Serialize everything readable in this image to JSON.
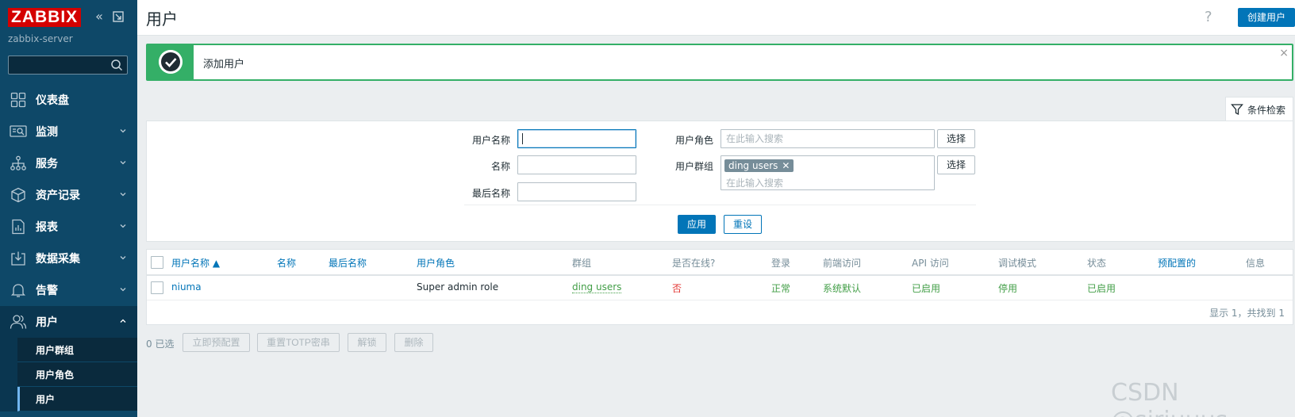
{
  "sidebar": {
    "logo": "ZABBIX",
    "server_name": "zabbix-server",
    "search_value": "",
    "items": [
      {
        "label": "仪表盘",
        "icon": "dashboard-icon"
      },
      {
        "label": "监测",
        "icon": "monitoring-icon"
      },
      {
        "label": "服务",
        "icon": "services-icon"
      },
      {
        "label": "资产记录",
        "icon": "inventory-icon"
      },
      {
        "label": "报表",
        "icon": "reports-icon"
      },
      {
        "label": "数据采集",
        "icon": "data-collection-icon"
      },
      {
        "label": "告警",
        "icon": "alerts-icon"
      },
      {
        "label": "用户",
        "icon": "users-icon"
      }
    ],
    "sub_items": [
      {
        "label": "用户群组"
      },
      {
        "label": "用户角色"
      },
      {
        "label": "用户"
      }
    ]
  },
  "header": {
    "title": "用户",
    "help": "?",
    "create_button": "创建用户"
  },
  "message": {
    "text": "添加用户",
    "close": "×"
  },
  "filter": {
    "tab_label": "条件检索",
    "username_label": "用户名称",
    "name_label": "名称",
    "lastname_label": "最后名称",
    "role_label": "用户角色",
    "role_placeholder": "在此输入搜索",
    "group_label": "用户群组",
    "group_tag": "ding users",
    "group_placeholder": "在此输入搜索",
    "select_label": "选择",
    "apply_label": "应用",
    "reset_label": "重设"
  },
  "table": {
    "headers": {
      "username": "用户名称 ▲",
      "name": "名称",
      "lastname": "最后名称",
      "role": "用户角色",
      "groups": "群组",
      "online": "是否在线?",
      "login": "登录",
      "frontend": "前端访问",
      "api": "API 访问",
      "debug": "调试模式",
      "status": "状态",
      "provisioned": "预配置的",
      "info": "信息"
    },
    "rows": [
      {
        "username": "niuma",
        "name": "",
        "lastname": "",
        "role": "Super admin role",
        "groups": "ding users",
        "online": "否",
        "login": "正常",
        "frontend": "系统默认",
        "api": "已启用",
        "debug": "停用",
        "status": "已启用",
        "provisioned": "",
        "info": ""
      }
    ],
    "paging": "显示 1，共找到 1"
  },
  "actions": {
    "selected": "0 已选",
    "provision_now": "立即预配置",
    "reset_totp": "重置TOTP密串",
    "unblock": "解锁",
    "delete": "删除"
  },
  "watermark": "CSDN @siriuuus",
  "colors": {
    "sidebar_bg": "#0e4868",
    "primary": "#0275b8",
    "success": "#34af67",
    "logo_red": "#d40000",
    "green_text": "#429e47",
    "red_text": "#e33734"
  }
}
